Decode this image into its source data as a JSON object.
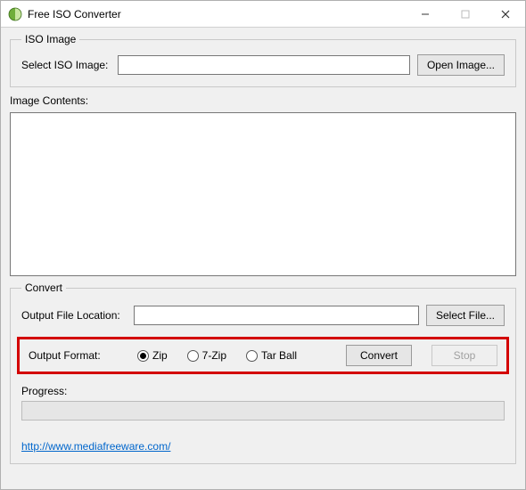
{
  "window": {
    "title": "Free ISO Converter"
  },
  "iso_image": {
    "legend": "ISO Image",
    "select_label": "Select ISO Image:",
    "path_value": "",
    "open_button": "Open Image..."
  },
  "contents": {
    "label": "Image Contents:"
  },
  "convert": {
    "legend": "Convert",
    "output_location_label": "Output File Location:",
    "output_location_value": "",
    "select_file_button": "Select File...",
    "output_format_label": "Output Format:",
    "formats": {
      "zip": "Zip",
      "sevenzip": "7-Zip",
      "tarball": "Tar Ball"
    },
    "selected_format": "zip",
    "convert_button": "Convert",
    "stop_button": "Stop",
    "progress_label": "Progress:"
  },
  "footer": {
    "link_text": "http://www.mediafreeware.com/"
  }
}
